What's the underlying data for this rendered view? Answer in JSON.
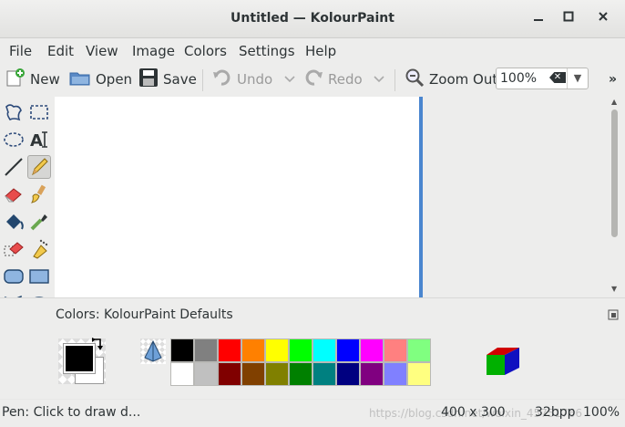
{
  "window": {
    "title": "Untitled — KolourPaint",
    "minimize_icon": "minimize-icon",
    "maximize_icon": "maximize-icon",
    "close_icon": "close-icon"
  },
  "menu": [
    "File",
    "Edit",
    "View",
    "Image",
    "Colors",
    "Settings",
    "Help"
  ],
  "toolbar": {
    "new_label": "New",
    "open_label": "Open",
    "save_label": "Save",
    "undo_label": "Undo",
    "redo_label": "Redo",
    "zoom_out_label": "Zoom Out",
    "zoom_value": "100%",
    "more_label": "»"
  },
  "colors": {
    "label": "Colors: KolourPaint Defaults",
    "foreground": "#000000",
    "background": "#ffffff",
    "palette_top": [
      "#000000",
      "#808080",
      "#ff0000",
      "#ff8000",
      "#ffff00",
      "#00ff00",
      "#00ffff",
      "#0000ff",
      "#ff00ff",
      "#ff8080",
      "#80ff80"
    ],
    "palette_bottom": [
      "#ffffff",
      "#c0c0c0",
      "#800000",
      "#804000",
      "#808000",
      "#008000",
      "#008080",
      "#000080",
      "#800080",
      "#8080ff",
      "#ffff80"
    ]
  },
  "status": {
    "message": "Pen: Click to draw d...",
    "dimensions": "400 x 300",
    "depth": "32bpp",
    "zoom": "100%",
    "watermark": "https://blog.csdn.net/weixin_45751766"
  }
}
